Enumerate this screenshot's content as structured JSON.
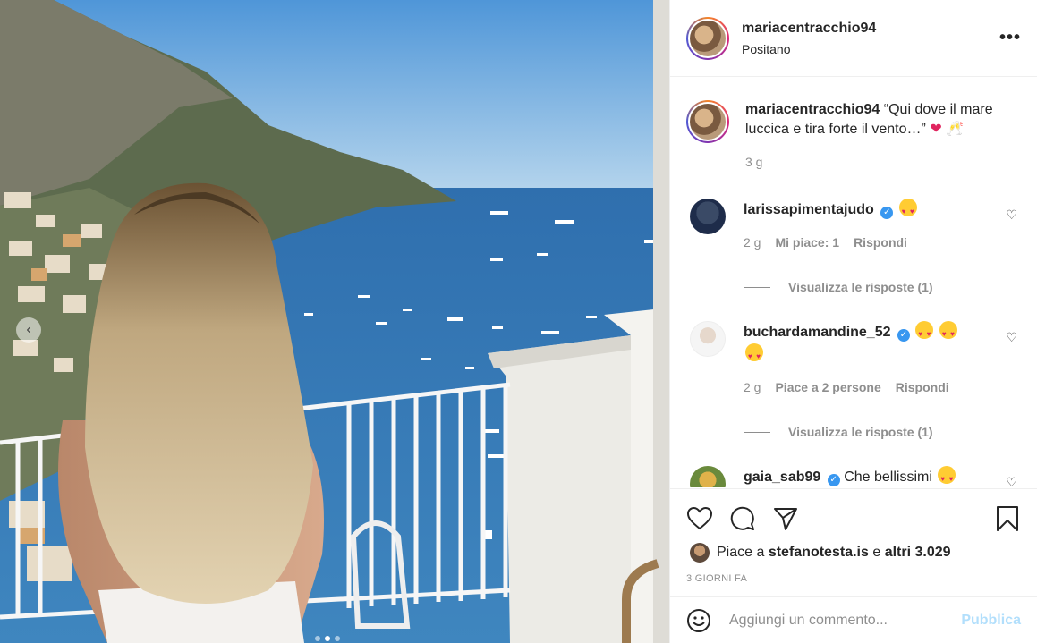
{
  "post": {
    "username": "mariacentracchio94",
    "location": "Positano",
    "more_icon": "ellipsis-icon",
    "caption_text": "“Qui dove il mare luccica e tira forte il vento…”",
    "caption_time": "3 g"
  },
  "comments": [
    {
      "username": "larissapimentajudo",
      "text": "",
      "time": "2 g",
      "likes": "Mi piace: 1",
      "reply": "Rispondi",
      "view_replies": "Visualizza le risposte (1)"
    },
    {
      "username": "buchardamandine_52",
      "text": "",
      "time": "2 g",
      "likes": "Piace a 2 persone",
      "reply": "Rispondi",
      "view_replies": "Visualizza le risposte (1)"
    },
    {
      "username": "gaia_sab99",
      "text": "Che bellissimi"
    }
  ],
  "likes_bar": {
    "prefix": "Piace a",
    "user": "stefanotesta.is",
    "and": "e",
    "others": "altri 3.029"
  },
  "timestamp": "3 GIORNI FA",
  "add_comment": {
    "placeholder": "Aggiungi un commento...",
    "publish": "Pubblica"
  },
  "colors": {
    "verified": "#3897f0",
    "publish_disabled": "#b2dffc",
    "muted": "#8e8e8e"
  }
}
